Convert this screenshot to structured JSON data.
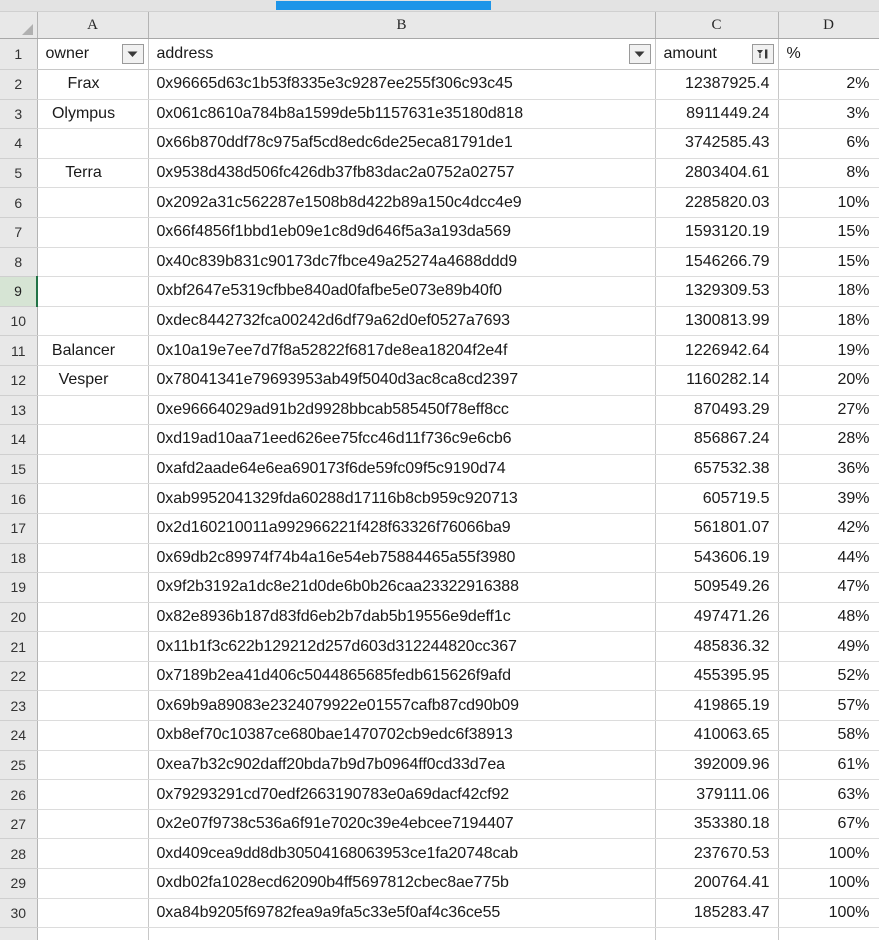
{
  "app": {
    "type": "spreadsheet",
    "selection_bar_color": "#1e95e8",
    "active_cell_color": "#217346",
    "active_row": 9
  },
  "column_headers": [
    "A",
    "B",
    "C",
    "D"
  ],
  "field_headers": {
    "a": "owner",
    "b": "address",
    "c": "amount",
    "d": "%"
  },
  "filters": {
    "owner_icon": "filter-dropdown-icon",
    "address_icon": "filter-dropdown-icon",
    "amount_icon": "sort-descending-filter-icon"
  },
  "rows": [
    {
      "n": "2",
      "owner": "Frax",
      "address": "0x96665d63c1b53f8335e3c9287ee255f306c93c45",
      "amount": "12387925.4",
      "pct": "2%"
    },
    {
      "n": "3",
      "owner": "Olympus",
      "address": "0x061c8610a784b8a1599de5b1157631e35180d818",
      "amount": "8911449.24",
      "pct": "3%"
    },
    {
      "n": "4",
      "owner": "",
      "address": "0x66b870ddf78c975af5cd8edc6de25eca81791de1",
      "amount": "3742585.43",
      "pct": "6%"
    },
    {
      "n": "5",
      "owner": "Terra",
      "address": "0x9538d438d506fc426db37fb83dac2a0752a02757",
      "amount": "2803404.61",
      "pct": "8%"
    },
    {
      "n": "6",
      "owner": "",
      "address": "0x2092a31c562287e1508b8d422b89a150c4dcc4e9",
      "amount": "2285820.03",
      "pct": "10%"
    },
    {
      "n": "7",
      "owner": "",
      "address": "0x66f4856f1bbd1eb09e1c8d9d646f5a3a193da569",
      "amount": "1593120.19",
      "pct": "15%"
    },
    {
      "n": "8",
      "owner": "",
      "address": "0x40c839b831c90173dc7fbce49a25274a4688ddd9",
      "amount": "1546266.79",
      "pct": "15%"
    },
    {
      "n": "9",
      "owner": "",
      "address": "0xbf2647e5319cfbbe840ad0fafbe5e073e89b40f0",
      "amount": "1329309.53",
      "pct": "18%"
    },
    {
      "n": "10",
      "owner": "",
      "address": "0xdec8442732fca00242d6df79a62d0ef0527a7693",
      "amount": "1300813.99",
      "pct": "18%"
    },
    {
      "n": "11",
      "owner": "Balancer",
      "address": "0x10a19e7ee7d7f8a52822f6817de8ea18204f2e4f",
      "amount": "1226942.64",
      "pct": "19%"
    },
    {
      "n": "12",
      "owner": "Vesper",
      "address": "0x78041341e79693953ab49f5040d3ac8ca8cd2397",
      "amount": "1160282.14",
      "pct": "20%"
    },
    {
      "n": "13",
      "owner": "",
      "address": "0xe96664029ad91b2d9928bbcab585450f78eff8cc",
      "amount": "870493.29",
      "pct": "27%"
    },
    {
      "n": "14",
      "owner": "",
      "address": "0xd19ad10aa71eed626ee75fcc46d11f736c9e6cb6",
      "amount": "856867.24",
      "pct": "28%"
    },
    {
      "n": "15",
      "owner": "",
      "address": "0xafd2aade64e6ea690173f6de59fc09f5c9190d74",
      "amount": "657532.38",
      "pct": "36%"
    },
    {
      "n": "16",
      "owner": "",
      "address": "0xab9952041329fda60288d17116b8cb959c920713",
      "amount": "605719.5",
      "pct": "39%"
    },
    {
      "n": "17",
      "owner": "",
      "address": "0x2d160210011a992966221f428f63326f76066ba9",
      "amount": "561801.07",
      "pct": "42%"
    },
    {
      "n": "18",
      "owner": "",
      "address": "0x69db2c89974f74b4a16e54eb75884465a55f3980",
      "amount": "543606.19",
      "pct": "44%"
    },
    {
      "n": "19",
      "owner": "",
      "address": "0x9f2b3192a1dc8e21d0de6b0b26caa23322916388",
      "amount": "509549.26",
      "pct": "47%"
    },
    {
      "n": "20",
      "owner": "",
      "address": "0x82e8936b187d83fd6eb2b7dab5b19556e9deff1c",
      "amount": "497471.26",
      "pct": "48%"
    },
    {
      "n": "21",
      "owner": "",
      "address": "0x11b1f3c622b129212d257d603d312244820cc367",
      "amount": "485836.32",
      "pct": "49%"
    },
    {
      "n": "22",
      "owner": "",
      "address": "0x7189b2ea41d406c5044865685fedb615626f9afd",
      "amount": "455395.95",
      "pct": "52%"
    },
    {
      "n": "23",
      "owner": "",
      "address": "0x69b9a89083e2324079922e01557cafb87cd90b09",
      "amount": "419865.19",
      "pct": "57%"
    },
    {
      "n": "24",
      "owner": "",
      "address": "0xb8ef70c10387ce680bae1470702cb9edc6f38913",
      "amount": "410063.65",
      "pct": "58%"
    },
    {
      "n": "25",
      "owner": "",
      "address": "0xea7b32c902daff20bda7b9d7b0964ff0cd33d7ea",
      "amount": "392009.96",
      "pct": "61%"
    },
    {
      "n": "26",
      "owner": "",
      "address": "0x79293291cd70edf2663190783e0a69dacf42cf92",
      "amount": "379111.06",
      "pct": "63%"
    },
    {
      "n": "27",
      "owner": "",
      "address": "0x2e07f9738c536a6f91e7020c39e4ebcee7194407",
      "amount": "353380.18",
      "pct": "67%"
    },
    {
      "n": "28",
      "owner": "",
      "address": "0xd409cea9dd8db30504168063953ce1fa20748cab",
      "amount": "237670.53",
      "pct": "100%"
    },
    {
      "n": "29",
      "owner": "",
      "address": "0xdb02fa1028ecd62090b4ff5697812cbec8ae775b",
      "amount": "200764.41",
      "pct": "100%"
    },
    {
      "n": "30",
      "owner": "",
      "address": "0xa84b9205f69782fea9a9fa5c33e5f0af4c36ce55",
      "amount": "185283.47",
      "pct": "100%"
    }
  ]
}
